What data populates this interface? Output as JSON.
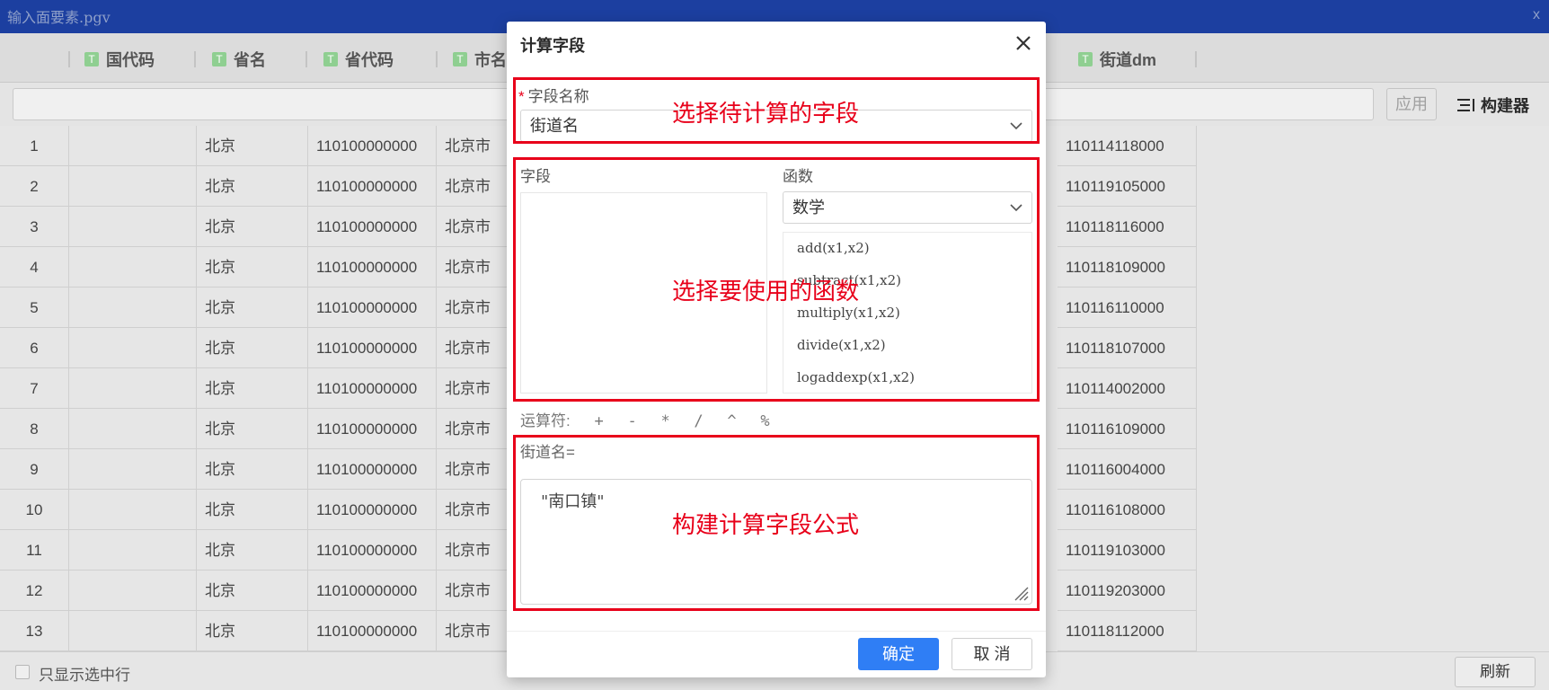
{
  "window": {
    "title": "输入面要素.pgv",
    "close_glyph": "x"
  },
  "columns": [
    {
      "label": "国代码"
    },
    {
      "label": "省名"
    },
    {
      "label": "省代码"
    },
    {
      "label": "市名"
    },
    {
      "label": "街道dm"
    }
  ],
  "column_type_glyph": "T",
  "toolbar": {
    "apply_label": "应用",
    "builder_label": "构建器"
  },
  "rows": [
    {
      "index": "1",
      "prov": "北京",
      "provcode": "110100000000",
      "city": "北京市",
      "street": "110114118000"
    },
    {
      "index": "2",
      "prov": "北京",
      "provcode": "110100000000",
      "city": "北京市",
      "street": "110119105000"
    },
    {
      "index": "3",
      "prov": "北京",
      "provcode": "110100000000",
      "city": "北京市",
      "street": "110118116000"
    },
    {
      "index": "4",
      "prov": "北京",
      "provcode": "110100000000",
      "city": "北京市",
      "street": "110118109000"
    },
    {
      "index": "5",
      "prov": "北京",
      "provcode": "110100000000",
      "city": "北京市",
      "street": "110116110000"
    },
    {
      "index": "6",
      "prov": "北京",
      "provcode": "110100000000",
      "city": "北京市",
      "street": "110118107000"
    },
    {
      "index": "7",
      "prov": "北京",
      "provcode": "110100000000",
      "city": "北京市",
      "street": "110114002000"
    },
    {
      "index": "8",
      "prov": "北京",
      "provcode": "110100000000",
      "city": "北京市",
      "street": "110116109000"
    },
    {
      "index": "9",
      "prov": "北京",
      "provcode": "110100000000",
      "city": "北京市",
      "street": "110116004000"
    },
    {
      "index": "10",
      "prov": "北京",
      "provcode": "110100000000",
      "city": "北京市",
      "street": "110116108000"
    },
    {
      "index": "11",
      "prov": "北京",
      "provcode": "110100000000",
      "city": "北京市",
      "street": "110119103000"
    },
    {
      "index": "12",
      "prov": "北京",
      "provcode": "110100000000",
      "city": "北京市",
      "street": "110119203000"
    },
    {
      "index": "13",
      "prov": "北京",
      "provcode": "110100000000",
      "city": "北京市",
      "street": "110118112000"
    }
  ],
  "footer": {
    "only_selected_label": "只显示选中行",
    "refresh_label": "刷新"
  },
  "modal": {
    "title": "计算字段",
    "field_name_label": "字段名称",
    "field_name_required_mark": "*",
    "field_name_value": "街道名",
    "fields_label": "字段",
    "functions_label": "函数",
    "function_category": "数学",
    "functions": [
      "add(x1,x2)",
      "subtract(x1,x2)",
      "multiply(x1,x2)",
      "divide(x1,x2)",
      "logaddexp(x1,x2)"
    ],
    "operators_label": "运算符:",
    "operators": [
      "+",
      "-",
      "*",
      "/",
      "^",
      "%"
    ],
    "expression_label": "街道名=",
    "expression_value": "\"南口镇\"",
    "ok_label": "确定",
    "cancel_label": "取 消"
  },
  "annotations": {
    "select_field": "选择待计算的字段",
    "select_function": "选择要使用的函数",
    "build_formula": "构建计算字段公式"
  },
  "colors": {
    "titlebar": "#1c3fa0",
    "annotation_red": "#e8001a",
    "primary_button": "#2f7ef5",
    "text_type_icon": "#8fcf91"
  }
}
